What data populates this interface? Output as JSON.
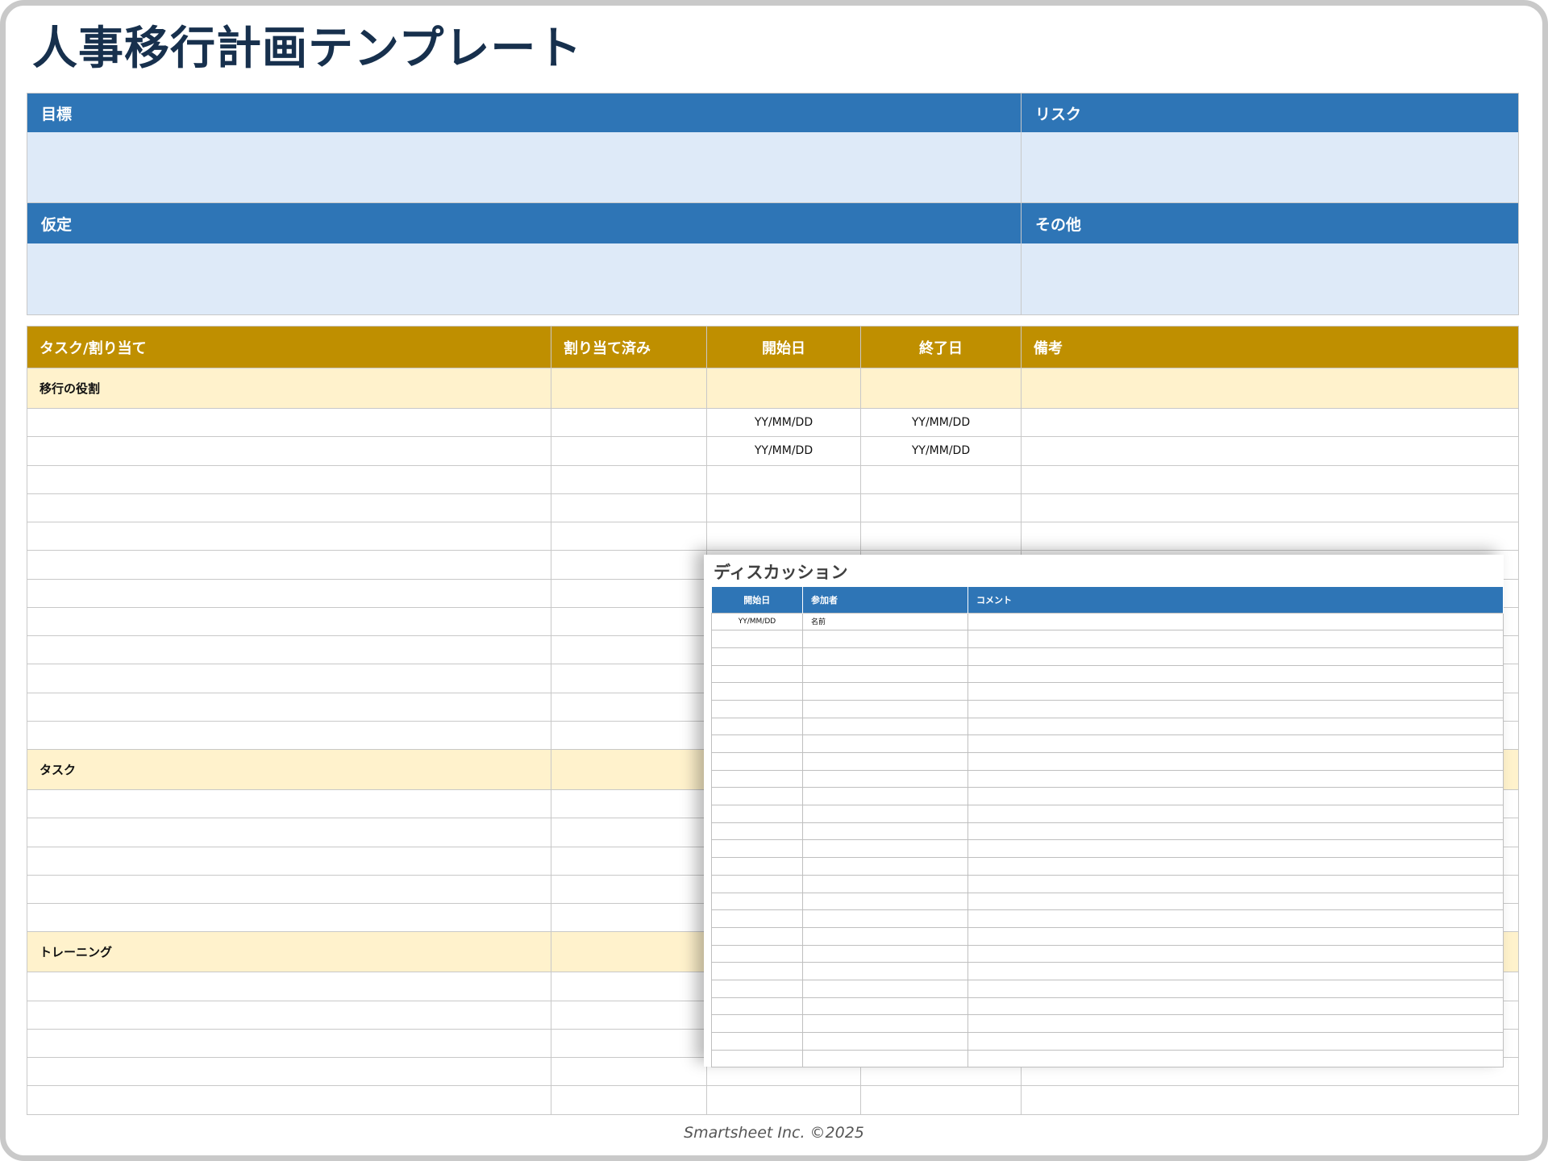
{
  "title": "人事移行計画テンプレート",
  "info": {
    "goal_label": "目標",
    "risk_label": "リスク",
    "assumption_label": "仮定",
    "other_label": "その他"
  },
  "tasks_table": {
    "headers": [
      "タスク/割り当て",
      "割り当て済み",
      "開始日",
      "終了日",
      "備考"
    ],
    "sections": [
      {
        "name": "移行の役割",
        "rows": [
          [
            "",
            "",
            "YY/MM/DD",
            "YY/MM/DD",
            ""
          ],
          [
            "",
            "",
            "YY/MM/DD",
            "YY/MM/DD",
            ""
          ],
          [
            "",
            "",
            "",
            "",
            ""
          ],
          [
            "",
            "",
            "",
            "",
            ""
          ],
          [
            "",
            "",
            "",
            "",
            ""
          ],
          [
            "",
            "",
            "",
            "",
            ""
          ],
          [
            "",
            "",
            "",
            "",
            ""
          ],
          [
            "",
            "",
            "",
            "",
            ""
          ],
          [
            "",
            "",
            "",
            "",
            ""
          ],
          [
            "",
            "",
            "",
            "",
            ""
          ],
          [
            "",
            "",
            "",
            "",
            ""
          ],
          [
            "",
            "",
            "",
            "",
            ""
          ]
        ]
      },
      {
        "name": "タスク",
        "rows": [
          [
            "",
            "",
            "",
            "",
            ""
          ],
          [
            "",
            "",
            "",
            "",
            ""
          ],
          [
            "",
            "",
            "",
            "",
            ""
          ],
          [
            "",
            "",
            "",
            "",
            ""
          ],
          [
            "",
            "",
            "",
            "",
            ""
          ]
        ]
      },
      {
        "name": "トレーニング",
        "rows": [
          [
            "",
            "",
            "",
            "",
            ""
          ],
          [
            "",
            "",
            "",
            "",
            ""
          ],
          [
            "",
            "",
            "",
            "",
            ""
          ],
          [
            "",
            "",
            "",
            "",
            ""
          ],
          [
            "",
            "",
            "",
            "",
            ""
          ]
        ]
      }
    ]
  },
  "discussion": {
    "title": "ディスカッション",
    "headers": [
      "開始日",
      "参加者",
      "コメント"
    ],
    "rows": [
      [
        "YY/MM/DD",
        "名前",
        ""
      ],
      [
        "",
        "",
        ""
      ],
      [
        "",
        "",
        ""
      ],
      [
        "",
        "",
        ""
      ],
      [
        "",
        "",
        ""
      ],
      [
        "",
        "",
        ""
      ],
      [
        "",
        "",
        ""
      ],
      [
        "",
        "",
        ""
      ],
      [
        "",
        "",
        ""
      ],
      [
        "",
        "",
        ""
      ],
      [
        "",
        "",
        ""
      ],
      [
        "",
        "",
        ""
      ],
      [
        "",
        "",
        ""
      ],
      [
        "",
        "",
        ""
      ],
      [
        "",
        "",
        ""
      ],
      [
        "",
        "",
        ""
      ],
      [
        "",
        "",
        ""
      ],
      [
        "",
        "",
        ""
      ],
      [
        "",
        "",
        ""
      ],
      [
        "",
        "",
        ""
      ],
      [
        "",
        "",
        ""
      ],
      [
        "",
        "",
        ""
      ],
      [
        "",
        "",
        ""
      ],
      [
        "",
        "",
        ""
      ],
      [
        "",
        "",
        ""
      ],
      [
        "",
        "",
        ""
      ]
    ]
  },
  "footer": "Smartsheet Inc. ©2025"
}
